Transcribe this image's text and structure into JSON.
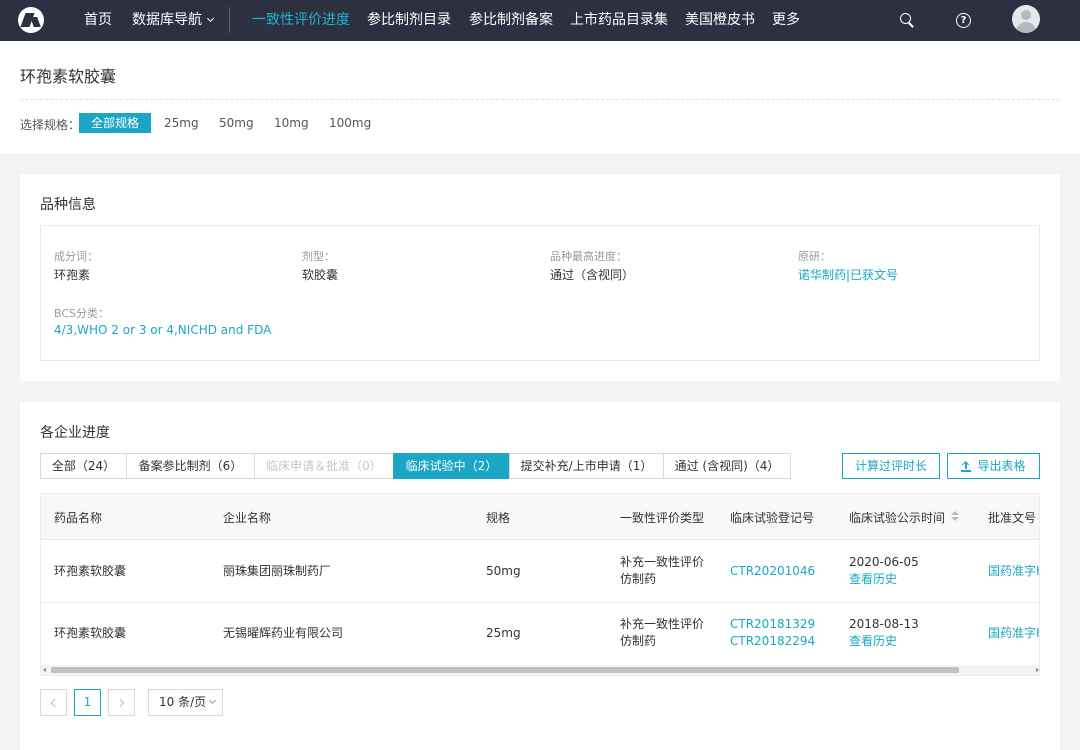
{
  "nav": {
    "items": [
      "首页",
      "数据库导航",
      "一致性评价进度",
      "参比制剂目录",
      "参比制剂备案",
      "上市药品目录集",
      "美国橙皮书",
      "更多"
    ],
    "active_index": 2,
    "accent": "#1fb4cf",
    "icons": [
      "logo-icon",
      "search-icon",
      "help-icon",
      "avatar-icon"
    ]
  },
  "header": {
    "title": "环孢素软胶囊",
    "spec_label": "选择规格：",
    "specs": [
      "全部规格",
      "25mg",
      "50mg",
      "10mg",
      "100mg"
    ],
    "active_spec": 0
  },
  "variety": {
    "title": "品种信息",
    "fields": [
      {
        "label": "成分词：",
        "value": "环孢素"
      },
      {
        "label": "剂型：",
        "value": "软胶囊"
      },
      {
        "label": "品种最高进度：",
        "value": "通过（含视同）"
      },
      {
        "label": "原研：",
        "value": "诺华制药|已获文号"
      },
      {
        "label": "BCS分类：",
        "value": "4/3,WHO 2 or 3 or 4,NICHD and FDA"
      }
    ]
  },
  "progress": {
    "title": "各企业进度",
    "tabs": [
      "全部（24）",
      "备案参比制剂（6）",
      "临床申请＆批准（0）",
      "临床试验中（2）",
      "提交补充/上市申请（1）",
      "通过 (含视同)（4）"
    ],
    "active_tab": 3,
    "disabled_tab": 2,
    "actions": {
      "calc": "计算过评时长",
      "export": "导出表格"
    },
    "columns": [
      "药品名称",
      "企业名称",
      "规格",
      "一致性评价类型",
      "临床试验登记号",
      "临床试验公示时间",
      "批准文号"
    ],
    "rows": [
      {
        "drug": "环孢素软胶囊",
        "company": "丽珠集团丽珠制药厂",
        "spec": "50mg",
        "type": [
          "补充一致性评价",
          "仿制药"
        ],
        "reg_nos": [
          "CTR20201046"
        ],
        "date": "2020-06-05",
        "history": "查看历史",
        "approval": "国药准字H"
      },
      {
        "drug": "环孢素软胶囊",
        "company": "无锡曜辉药业有限公司",
        "spec": "25mg",
        "type": [
          "补充一致性评价",
          "仿制药"
        ],
        "reg_nos": [
          "CTR20181329",
          "CTR20182294"
        ],
        "date": "2018-08-13",
        "history": "查看历史",
        "approval": "国药准字H"
      }
    ],
    "pagination": {
      "current": "1",
      "page_size": "10 条/页"
    }
  }
}
